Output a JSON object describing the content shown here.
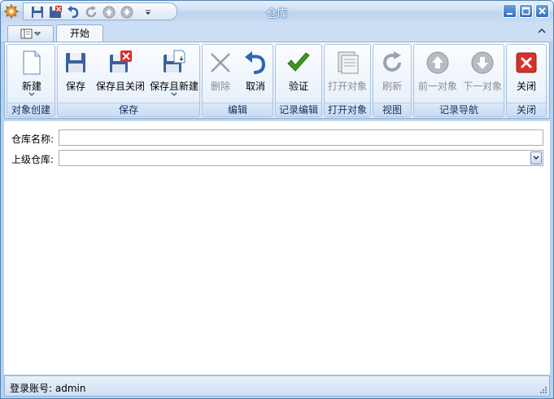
{
  "window": {
    "title": "仓库",
    "title_color": "#ffffff",
    "frame_color": "#b9d1ea"
  },
  "quick_access": [
    {
      "icon": "save-icon"
    },
    {
      "icon": "save-close-icon"
    },
    {
      "icon": "undo-icon"
    },
    {
      "icon": "refresh-icon"
    },
    {
      "icon": "up-icon"
    },
    {
      "icon": "down-icon"
    },
    {
      "icon": "customize-dropdown-icon"
    }
  ],
  "tabs": {
    "active": "开始"
  },
  "ribbon": {
    "groups": {
      "object_create": "对象创建",
      "save": "保存",
      "edit": "编辑",
      "record_edit": "记录编辑",
      "open_object": "打开对象",
      "view": "视图",
      "record_nav": "记录导航",
      "close": "关闭"
    },
    "buttons": {
      "new": "新建",
      "save": "保存",
      "save_close": "保存且关闭",
      "save_new": "保存且新建",
      "delete": "删除",
      "cancel": "取消",
      "validate": "验证",
      "open_object": "打开对象",
      "refresh": "刷新",
      "prev_object": "前一对象",
      "next_object": "下一对象",
      "close": "关闭"
    },
    "colors": {
      "validate": "#3a9a1e",
      "close": "#d9302a",
      "disabled_text": "#8d8d8d"
    }
  },
  "form": {
    "warehouse_name_label": "仓库名称:",
    "warehouse_name_value": "",
    "parent_warehouse_label": "上级仓库:",
    "parent_warehouse_value": ""
  },
  "status": {
    "text": "登录账号: admin"
  }
}
